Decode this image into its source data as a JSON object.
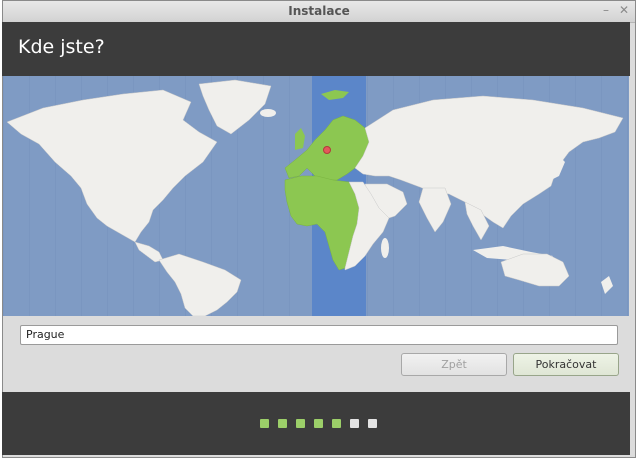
{
  "window": {
    "title": "Instalace",
    "controls": [
      "–",
      "✕"
    ]
  },
  "header": {
    "heading": "Kde jste?"
  },
  "map": {
    "selected_city": "Prague",
    "land_color": "#f0efec",
    "selected_color": "#8cc751",
    "ocean_color": "#7f9bc4",
    "band_color": "#5b86c9"
  },
  "location_input": {
    "value": "Prague"
  },
  "buttons": {
    "back": "Zpět",
    "next": "Pokračovat"
  },
  "progress": {
    "total_steps": 7,
    "completed_steps": 5,
    "done_color": "#9ccf69",
    "todo_color": "#e4e4e4"
  }
}
